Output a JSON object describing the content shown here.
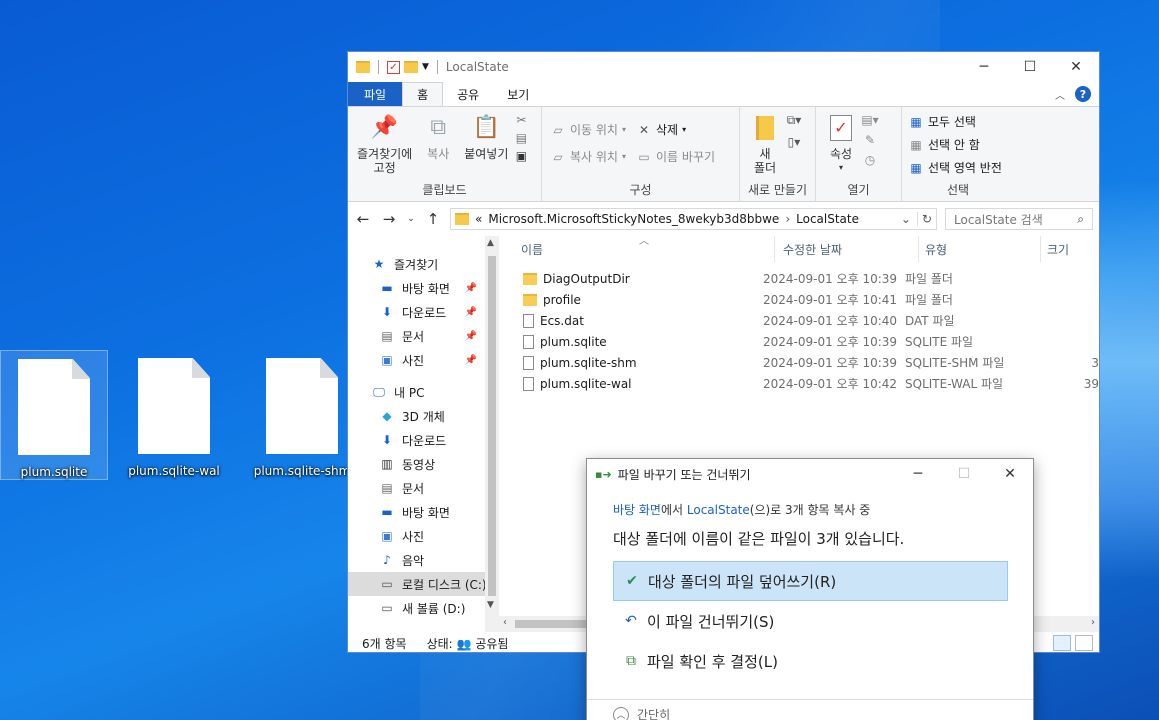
{
  "desktop": {
    "icons": [
      {
        "label": "plum.sqlite"
      },
      {
        "label": "plum.sqlite-wal"
      },
      {
        "label": "plum.sqlite-shm"
      }
    ]
  },
  "window": {
    "title": "LocalState"
  },
  "ribbon": {
    "tabs": [
      "파일",
      "홈",
      "공유",
      "보기"
    ],
    "clipboard": {
      "pin_line1": "즐겨찾기에",
      "pin_line2": "고정",
      "copy": "복사",
      "paste": "붙여넣기",
      "group": "클립보드"
    },
    "organize": {
      "move_to": "이동 위치",
      "copy_to": "복사 위치",
      "delete": "삭제",
      "rename": "이름 바꾸기",
      "group": "구성"
    },
    "new": {
      "new_folder_line1": "새",
      "new_folder_line2": "폴더",
      "group": "새로 만들기"
    },
    "open": {
      "properties": "속성",
      "group": "열기"
    },
    "select": {
      "select_all": "모두 선택",
      "select_none": "선택 안 함",
      "invert": "선택 영역 반전",
      "group": "선택"
    }
  },
  "address": {
    "overflow": "«",
    "path": [
      "Microsoft.MicrosoftStickyNotes_8wekyb3d8bbwe",
      "LocalState"
    ],
    "search_placeholder": "LocalState 검색"
  },
  "nav": {
    "quick_access": "즐겨찾기",
    "quick_items": [
      "바탕 화면",
      "다운로드",
      "문서",
      "사진"
    ],
    "this_pc": "내 PC",
    "pc_items": [
      "3D 개체",
      "다운로드",
      "동영상",
      "문서",
      "바탕 화면",
      "사진",
      "음악",
      "로컬 디스크 (C:)",
      "새 볼륨 (D:)"
    ]
  },
  "columns": {
    "name": "이름",
    "modified": "수정한 날짜",
    "type": "유형",
    "size": "크기"
  },
  "files": [
    {
      "name": "DiagOutputDir",
      "date": "2024-09-01 오후 10:39",
      "type": "파일 폴더",
      "size": "",
      "kind": "folder"
    },
    {
      "name": "profile",
      "date": "2024-09-01 오후 10:41",
      "type": "파일 폴더",
      "size": "",
      "kind": "folder"
    },
    {
      "name": "Ecs.dat",
      "date": "2024-09-01 오후 10:40",
      "type": "DAT 파일",
      "size": "",
      "kind": "file"
    },
    {
      "name": "plum.sqlite",
      "date": "2024-09-01 오후 10:39",
      "type": "SQLITE 파일",
      "size": "",
      "kind": "file"
    },
    {
      "name": "plum.sqlite-shm",
      "date": "2024-09-01 오후 10:39",
      "type": "SQLITE-SHM 파일",
      "size": "3",
      "kind": "file"
    },
    {
      "name": "plum.sqlite-wal",
      "date": "2024-09-01 오후 10:42",
      "type": "SQLITE-WAL 파일",
      "size": "39",
      "kind": "file"
    }
  ],
  "status": {
    "count": "6개 항목",
    "state_label": "상태:",
    "state_value": "공유됨"
  },
  "dialog": {
    "title": "파일 바꾸기 또는 건너뛰기",
    "sub_source": "바탕 화면",
    "sub_mid1": "에서 ",
    "sub_dest": "LocalState",
    "sub_end": "(으)로 3개 항목 복사 중",
    "heading": "대상 폴더에 이름이 같은 파일이 3개 있습니다.",
    "opt_replace": "대상 폴더의 파일 덮어쓰기(R)",
    "opt_skip": "이 파일 건너뛰기(S)",
    "opt_compare": "파일 확인 후 결정(L)",
    "footer": "간단히"
  }
}
